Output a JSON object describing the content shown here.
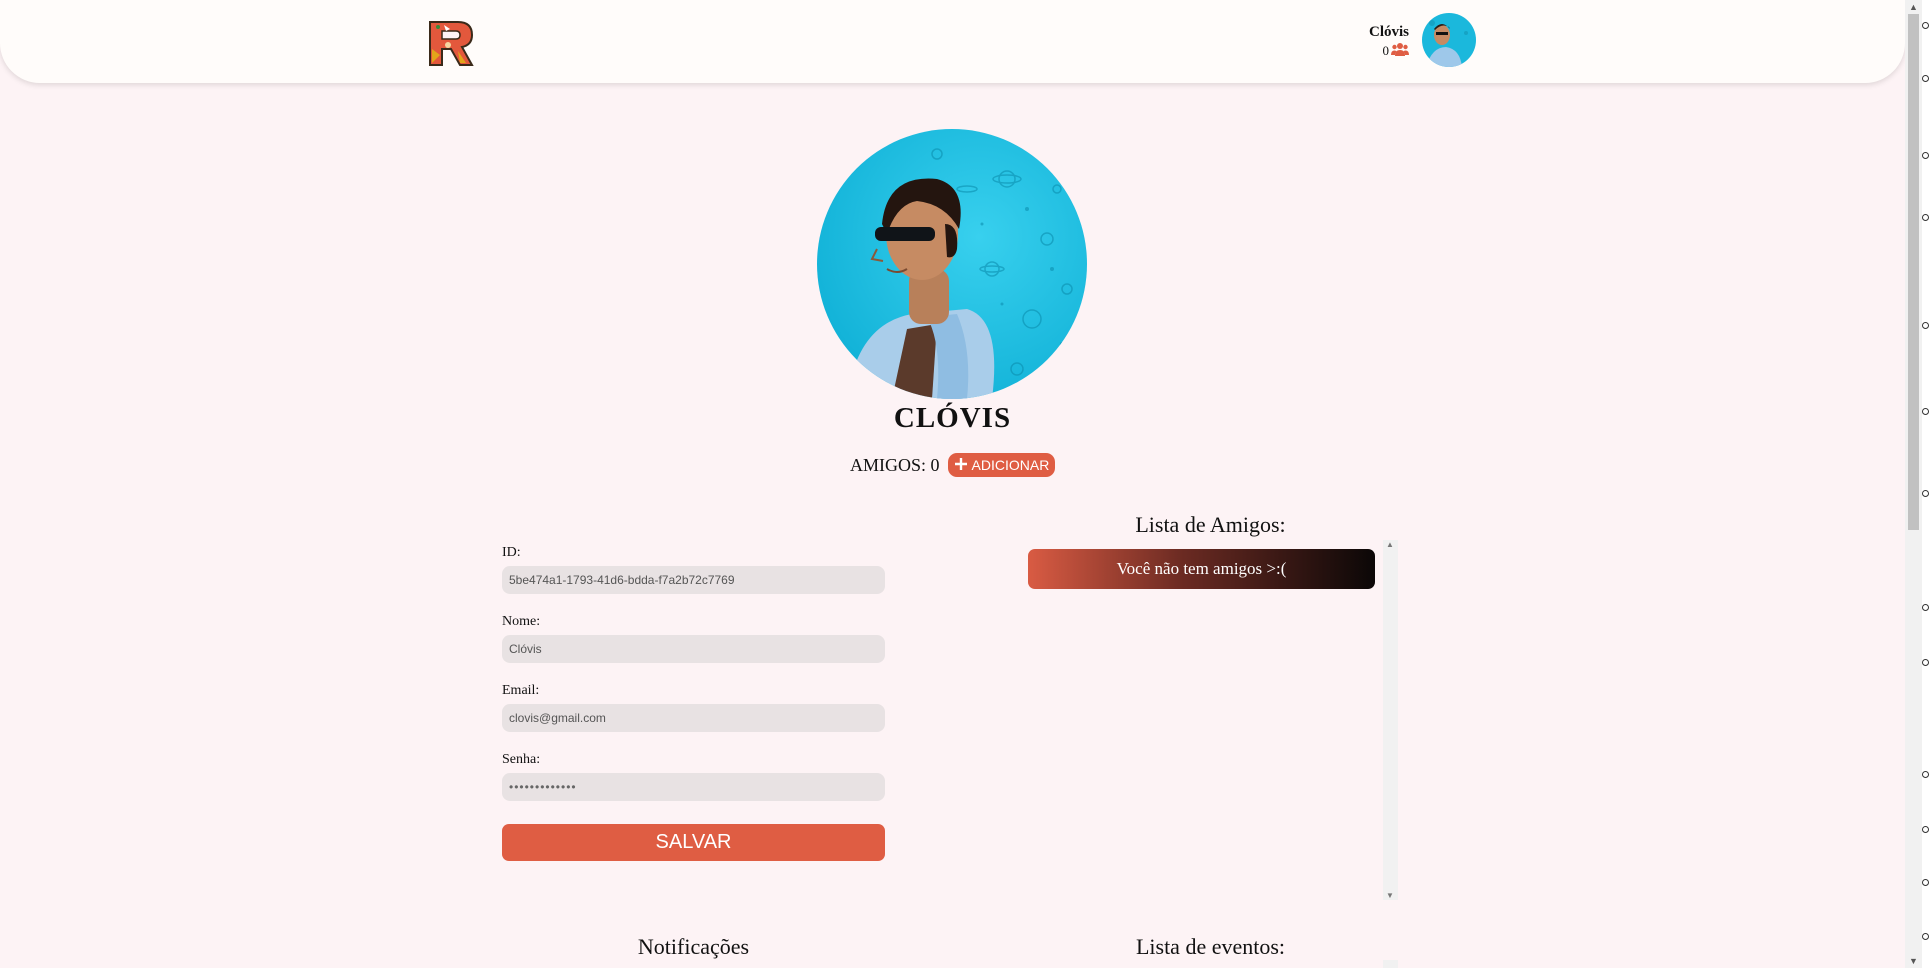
{
  "header": {
    "user_name": "Clóvis",
    "friend_count": "0"
  },
  "profile": {
    "name": "CLÓVIS",
    "friends_label": "AMIGOS: 0",
    "add_label": "ADICIONAR"
  },
  "form": {
    "id_label": "ID:",
    "id_value": "5be474a1-1793-41d6-bdda-f7a2b72c7769",
    "name_label": "Nome:",
    "name_value": "Clóvis",
    "email_label": "Email:",
    "email_value": "clovis@gmail.com",
    "password_label": "Senha:",
    "password_value": "•••••••••••••",
    "save_label": "SALVAR"
  },
  "friends_list": {
    "title": "Lista de Amigos:",
    "empty_text": "Você não tem amigos >:("
  },
  "notifications": {
    "title": "Notificações"
  },
  "events": {
    "title": "Lista de eventos:"
  },
  "colors": {
    "accent": "#df5d43",
    "background": "#fdf3f5",
    "header": "#fffcfa",
    "input_bg": "#e8e2e3"
  },
  "icons": [
    "logo-icon",
    "friends-group-icon",
    "plus-icon",
    "avatar"
  ]
}
